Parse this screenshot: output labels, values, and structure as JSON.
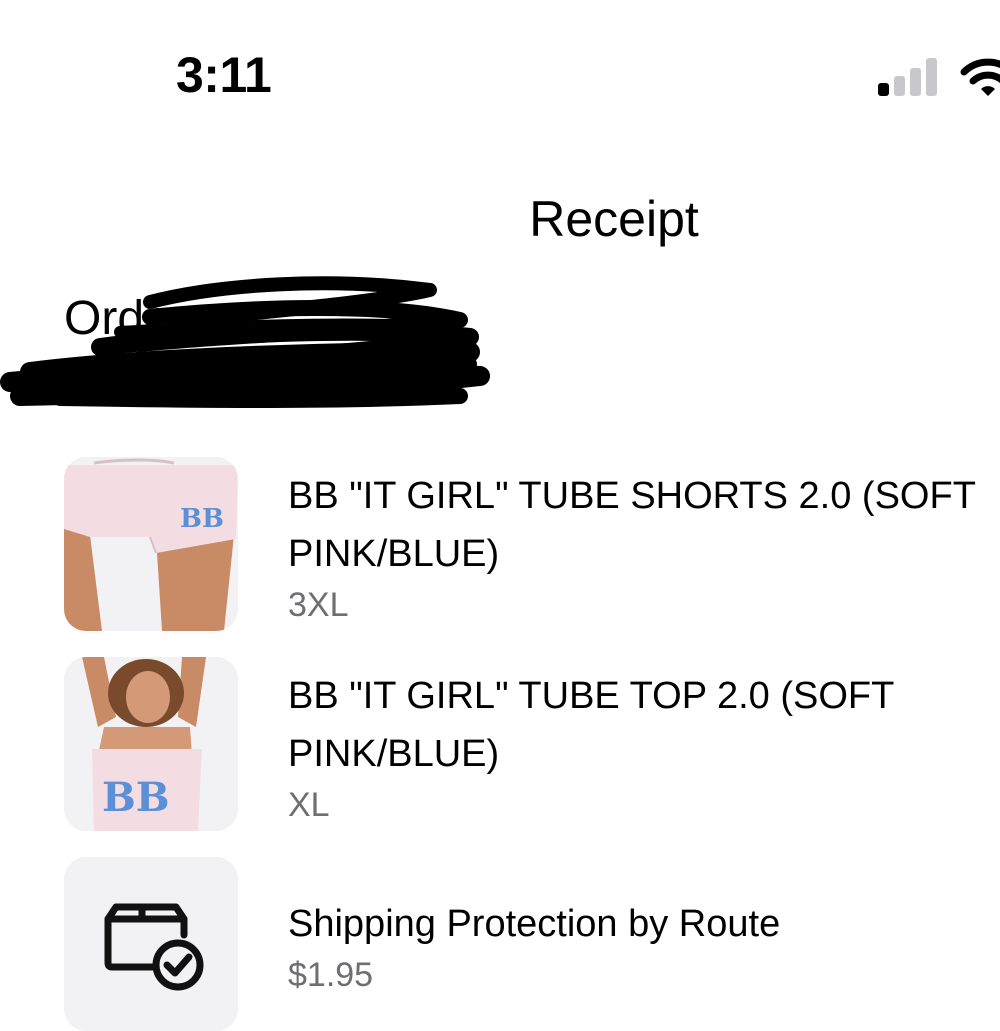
{
  "status_bar": {
    "time": "3:11"
  },
  "header": {
    "title": "Receipt"
  },
  "order": {
    "label": "Order"
  },
  "items": [
    {
      "name": "BB \"IT GIRL\" TUBE SHORTS 2.0 (SOFT PINK/BLUE)",
      "detail": "3XL",
      "thumbnail_text": "BB"
    },
    {
      "name": "BB \"IT GIRL\" TUBE TOP 2.0 (SOFT PINK/BLUE)",
      "detail": "XL",
      "thumbnail_text": "BB"
    },
    {
      "name": "Shipping Protection by Route",
      "detail": "$1.95",
      "icon": "package-check-icon"
    }
  ],
  "colors": {
    "background": "#ffffff",
    "text": "#000000",
    "secondary_text": "#6e6e73",
    "thumbnail_bg": "#f2f2f4",
    "garment_pink": "#f3dde3",
    "logo_blue": "#5b8fd6"
  }
}
